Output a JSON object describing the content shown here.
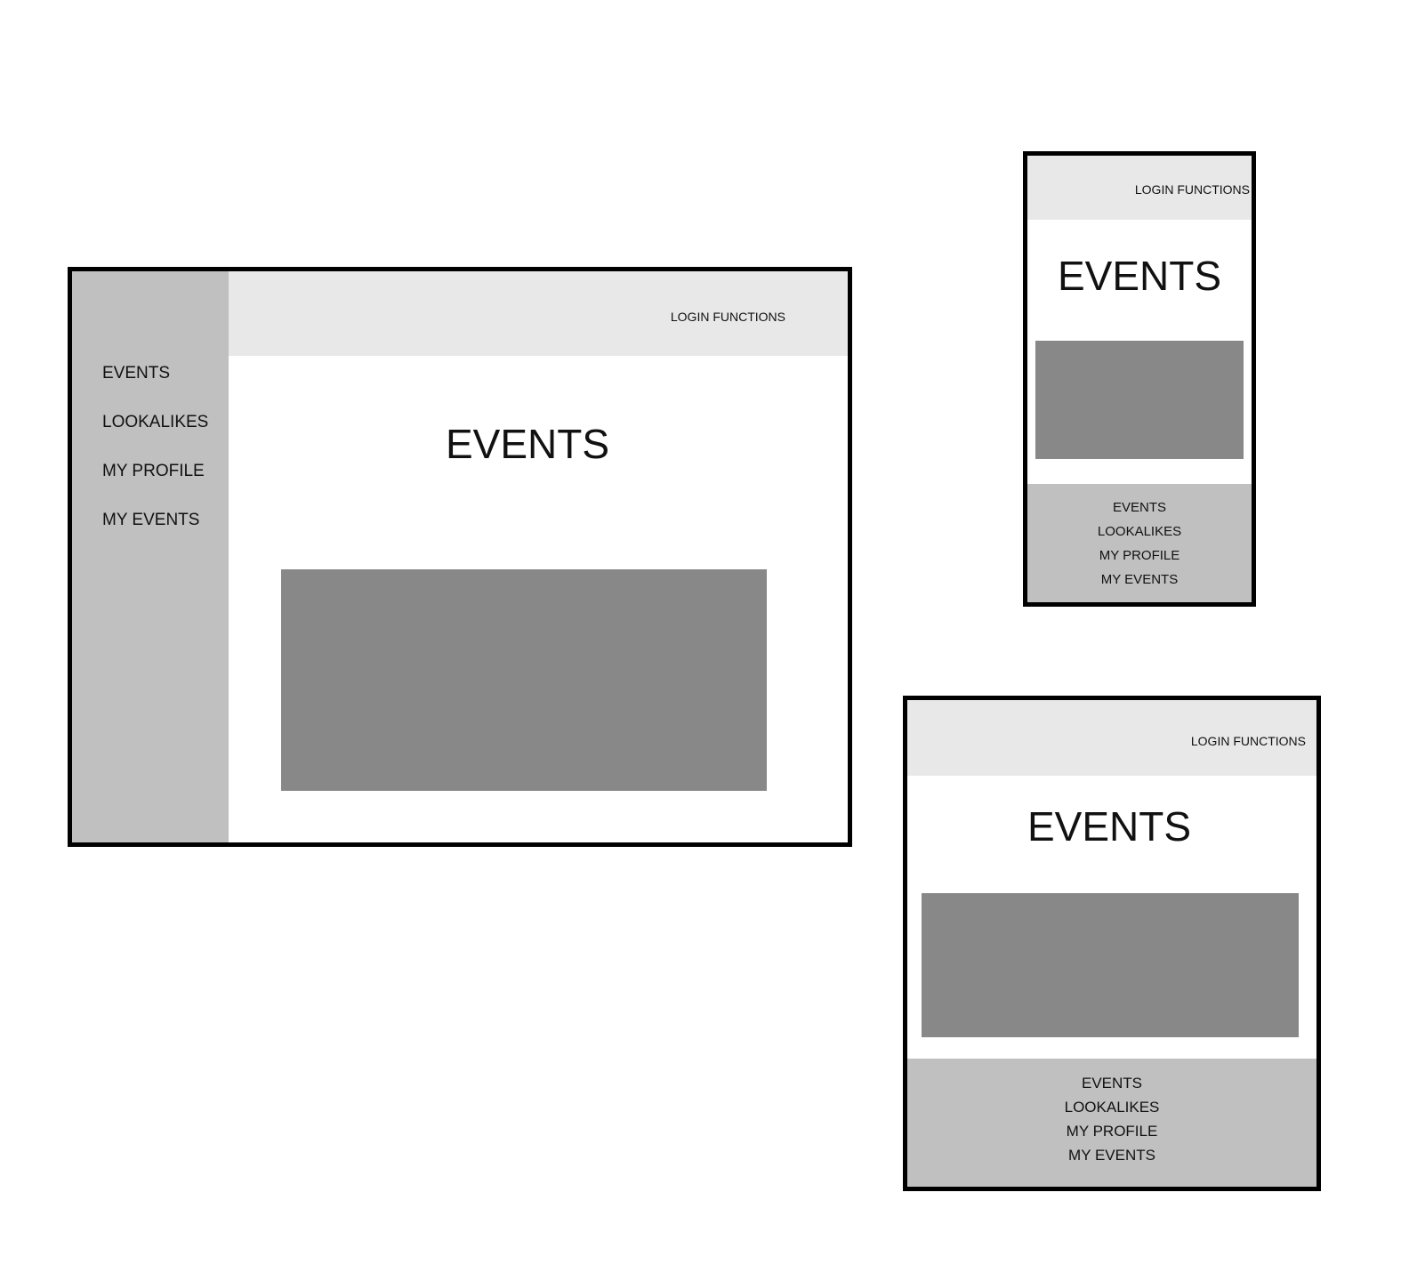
{
  "colors": {
    "frame_border": "#000000",
    "sidebar_bg": "#c0c0c0",
    "header_bg": "#e8e8e8",
    "media_placeholder": "#888888",
    "page_bg": "#ffffff"
  },
  "desktop": {
    "login_label": "LOGIN FUNCTIONS",
    "title": "EVENTS",
    "nav": [
      "EVENTS",
      "LOOKALIKES",
      "MY PROFILE",
      "MY EVENTS"
    ]
  },
  "phone": {
    "login_label": "LOGIN FUNCTIONS",
    "title": "EVENTS",
    "nav": [
      "EVENTS",
      "LOOKALIKES",
      "MY PROFILE",
      "MY EVENTS"
    ]
  },
  "tablet": {
    "login_label": "LOGIN FUNCTIONS",
    "title": "EVENTS",
    "nav": [
      "EVENTS",
      "LOOKALIKES",
      "MY PROFILE",
      "MY EVENTS"
    ]
  }
}
